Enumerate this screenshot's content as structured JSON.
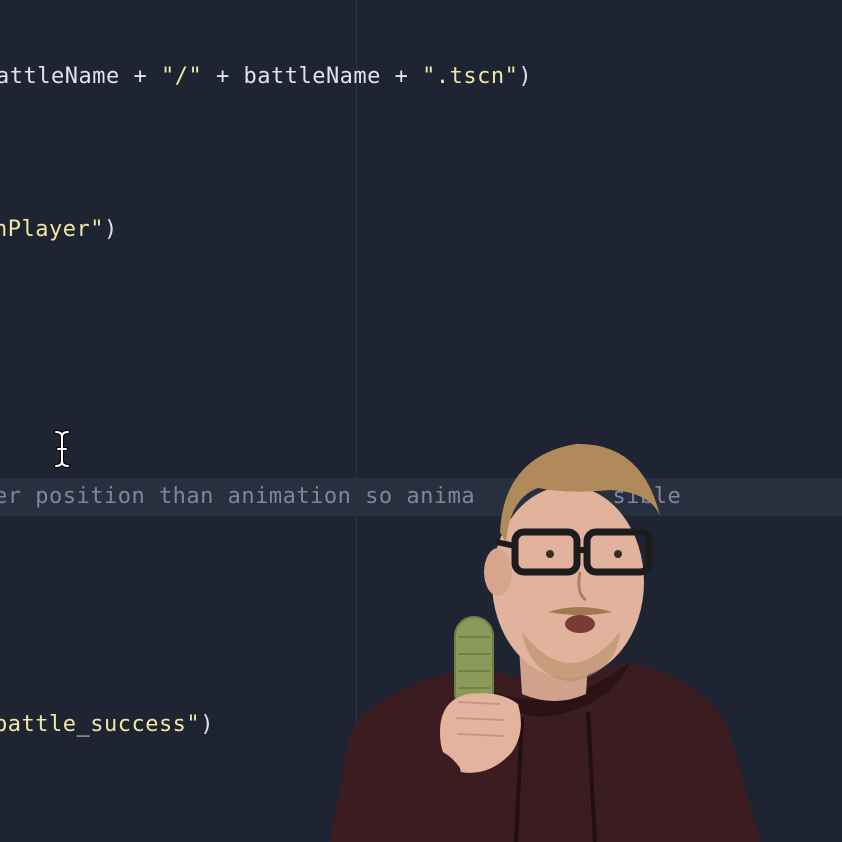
{
  "editor": {
    "lines": [
      {
        "tokens": [
          {
            "t": "id",
            "v": "attleName"
          },
          {
            "t": "op",
            "v": " + "
          },
          {
            "t": "str",
            "v": "\"/\""
          },
          {
            "t": "op",
            "v": " + "
          },
          {
            "t": "id",
            "v": "battleName"
          },
          {
            "t": "op",
            "v": " + "
          },
          {
            "t": "str",
            "v": "\".tscn\""
          },
          {
            "t": "id",
            "v": ")"
          }
        ]
      },
      {
        "tokens": [
          {
            "t": "str",
            "v": "nPlayer\""
          },
          {
            "t": "id",
            "v": ")"
          }
        ]
      },
      {
        "tokens": [
          {
            "t": "comment",
            "v": "er position than animation so anima          sible"
          }
        ]
      },
      {
        "tokens": [
          {
            "t": "str",
            "v": "battle_success\""
          },
          {
            "t": "id",
            "v": ")"
          }
        ]
      }
    ]
  },
  "colors": {
    "background": "#1e2431",
    "current_line": "#283040",
    "identifier": "#dfe3ea",
    "string": "#f0e6a6",
    "comment": "#7e8799",
    "hoodie": "#3b1c20",
    "microphone": "#8a9a5b"
  },
  "icons": {
    "text_cursor": "i-beam-cursor-icon"
  }
}
